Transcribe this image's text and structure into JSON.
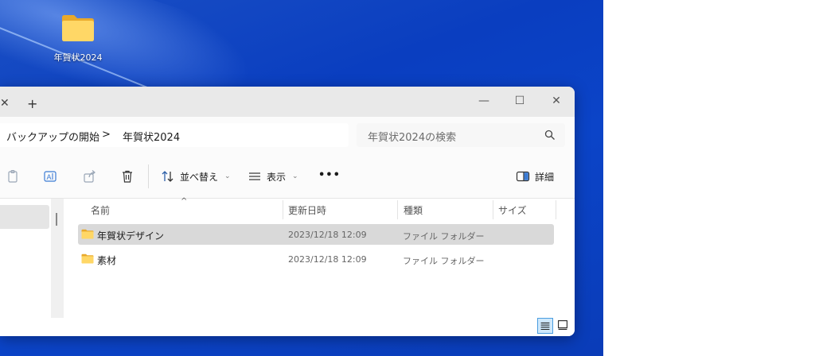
{
  "desktop": {
    "icon_label": "年賀状2024"
  },
  "window": {
    "tab_close_glyph": "✕",
    "new_tab_glyph": "+",
    "controls": {
      "minimize": "—",
      "maximize": "☐",
      "close": "✕"
    },
    "breadcrumb": {
      "parent": "バックアップの開始",
      "separator": ">",
      "current": "年賀状2024"
    },
    "search": {
      "placeholder": "年賀状2024の検索"
    },
    "toolbar": {
      "sort_label": "並べ替え",
      "view_label": "表示",
      "more_label": "•••",
      "details_label": "詳細"
    },
    "columns": {
      "name": "名前",
      "modified": "更新日時",
      "type": "種類",
      "size": "サイズ",
      "sort_indicator": "^"
    },
    "files": [
      {
        "name": "年賀状デザイン",
        "modified": "2023/12/18 12:09",
        "type": "ファイル フォルダー",
        "selected": true
      },
      {
        "name": "素材",
        "modified": "2023/12/18 12:09",
        "type": "ファイル フォルダー",
        "selected": false
      }
    ]
  },
  "colors": {
    "desktop_blue": "#0a3ec0",
    "folder_yellow": "#f5c542",
    "selection_gray": "#d9d9d9",
    "active_view_blue": "#4a9de0"
  }
}
